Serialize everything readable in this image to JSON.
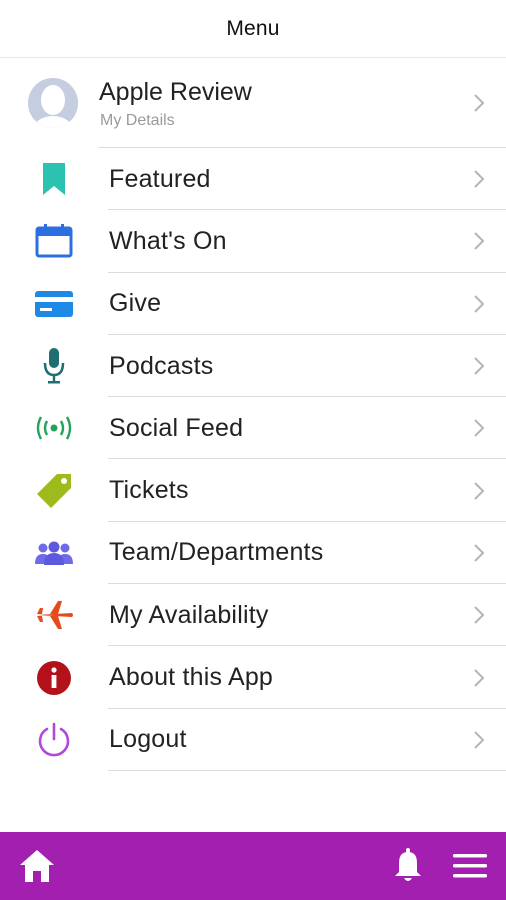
{
  "header": {
    "title": "Menu"
  },
  "profile": {
    "name": "Apple Review",
    "subtitle": "My Details"
  },
  "menu": {
    "items": [
      {
        "label": "Featured",
        "icon": "bookmark-icon",
        "color": "#2cc2b0"
      },
      {
        "label": "What's On",
        "icon": "calendar-icon",
        "color": "#2d6fe0"
      },
      {
        "label": "Give",
        "icon": "credit-card-icon",
        "color": "#1e88e5"
      },
      {
        "label": "Podcasts",
        "icon": "microphone-icon",
        "color": "#1f6e73"
      },
      {
        "label": "Social Feed",
        "icon": "broadcast-icon",
        "color": "#23a35a"
      },
      {
        "label": "Tickets",
        "icon": "tag-icon",
        "color": "#9dbb1a"
      },
      {
        "label": "Team/Departments",
        "icon": "group-icon",
        "color": "#6d6be8"
      },
      {
        "label": "My Availability",
        "icon": "airplane-icon",
        "color": "#e44b1d"
      },
      {
        "label": "About this App",
        "icon": "info-icon",
        "color": "#b3121b"
      },
      {
        "label": "Logout",
        "icon": "power-icon",
        "color": "#b049d8"
      }
    ]
  },
  "bottom_bar": {
    "color": "#a21fb0",
    "icons": [
      "home-icon",
      "bell-icon",
      "hamburger-menu-icon"
    ]
  }
}
